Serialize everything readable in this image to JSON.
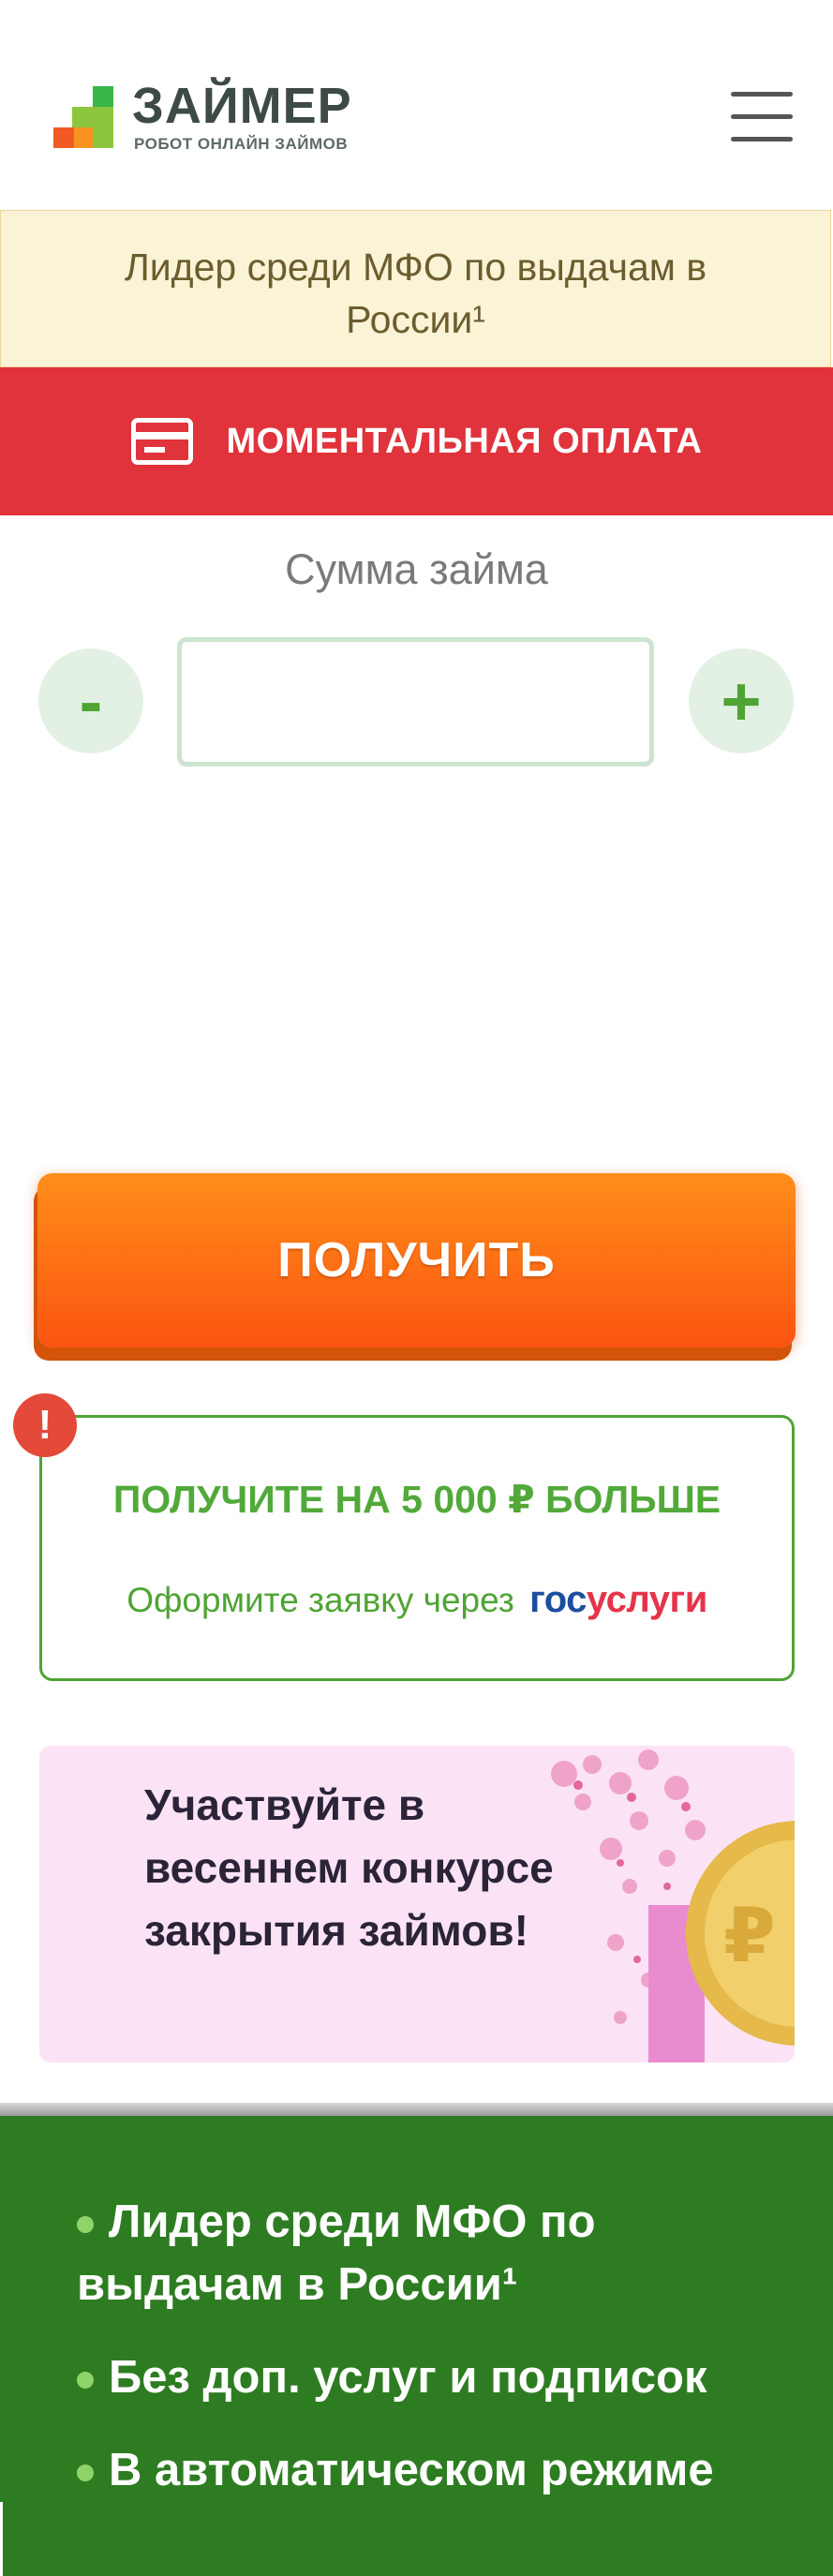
{
  "brand": {
    "name": "ЗАЙМЕР",
    "tagline": "РОБОТ ОНЛАЙН ЗАЙМОВ",
    "logo_colors": [
      "#f7931e",
      "#8cc63f",
      "#39b54a",
      "#f15a24"
    ]
  },
  "header": {
    "menu_icon": "hamburger-menu-icon"
  },
  "promo_bar": {
    "text": "Лидер среди МФО по выдачам в России¹"
  },
  "instant_payment": {
    "icon": "credit-card-icon",
    "label": "МОМЕНТАЛЬНАЯ ОПЛАТА"
  },
  "loan_amount": {
    "label": "Сумма займа",
    "decrement_label": "-",
    "increment_label": "+",
    "value": ""
  },
  "get_button": {
    "label": "ПОЛУЧИТЬ"
  },
  "gosuslugi_offer": {
    "badge": "!",
    "title": "ПОЛУЧИТЕ НА 5 000 ₽ БОЛЬШЕ",
    "subtitle": "Оформите заявку через",
    "logo_part1": "гос",
    "logo_part2": "услуги"
  },
  "contest_banner": {
    "text": "Участвуйте в весеннем конкурсе закрытия займов!"
  },
  "features": {
    "items": [
      {
        "text": "Лидер среди МФО по выдачам в России¹"
      },
      {
        "text": "Без доп. услуг и подписок"
      },
      {
        "text": "В автоматическом режиме"
      }
    ]
  },
  "colors": {
    "red_bar": "#e0333c",
    "orange_button": "#fb6a12",
    "green_accent": "#4fa434",
    "features_bg": "#2e7c22",
    "promo_bg": "#fbf3d6"
  }
}
